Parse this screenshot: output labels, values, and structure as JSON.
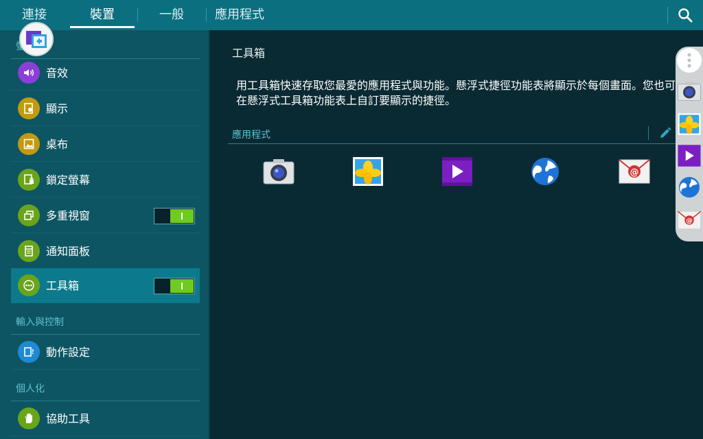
{
  "tabs": [
    {
      "label": "連接",
      "active": false
    },
    {
      "label": "裝置",
      "active": true
    },
    {
      "label": "一般",
      "active": false
    },
    {
      "label": "應用程式",
      "active": false
    }
  ],
  "search_icon": "search-icon",
  "sidebar": {
    "section_display": "螢幕與顯示",
    "section_display_visible": "螢 顯示",
    "items_display": [
      {
        "label": "音效",
        "icon": "speaker-icon",
        "color": "#8b3fd8"
      },
      {
        "label": "顯示",
        "icon": "display-icon",
        "color": "#c29a0f"
      },
      {
        "label": "桌布",
        "icon": "wallpaper-icon",
        "color": "#c29a0f"
      },
      {
        "label": "鎖定螢幕",
        "icon": "lock-screen-icon",
        "color": "#6aa41a"
      },
      {
        "label": "多重視窗",
        "icon": "multi-window-icon",
        "color": "#6aa41a",
        "toggle": true
      },
      {
        "label": "通知面板",
        "icon": "notification-panel-icon",
        "color": "#6aa41a"
      },
      {
        "label": "工具箱",
        "icon": "toolbox-icon",
        "color": "#6aa41a",
        "toggle": true,
        "selected": true
      }
    ],
    "section_input": "輸入與控制",
    "items_input": [
      {
        "label": "動作設定",
        "icon": "motion-icon",
        "color": "#1f8ad4"
      }
    ],
    "section_personal": "個人化",
    "items_personal": [
      {
        "label": "協助工具",
        "icon": "accessibility-icon",
        "color": "#6aa41a"
      }
    ]
  },
  "main": {
    "title": "工具箱",
    "description": "用工具箱快速存取您最愛的應用程式與功能。懸浮式捷徑功能表將顯示於每個畫面。您也可在懸浮式工具箱功能表上自訂要顯示的捷徑。",
    "apps_header": "應用程式",
    "apps": [
      {
        "icon": "camera-icon"
      },
      {
        "icon": "gallery-icon"
      },
      {
        "icon": "video-icon"
      },
      {
        "icon": "internet-icon"
      },
      {
        "icon": "email-icon"
      }
    ]
  },
  "colors": {
    "topbar": "#0c6f80",
    "sidebar": "#0d5563",
    "selected": "#0c7a8c",
    "accent_text": "#5fc2d2",
    "toggle_on": "#6ecb1f"
  }
}
